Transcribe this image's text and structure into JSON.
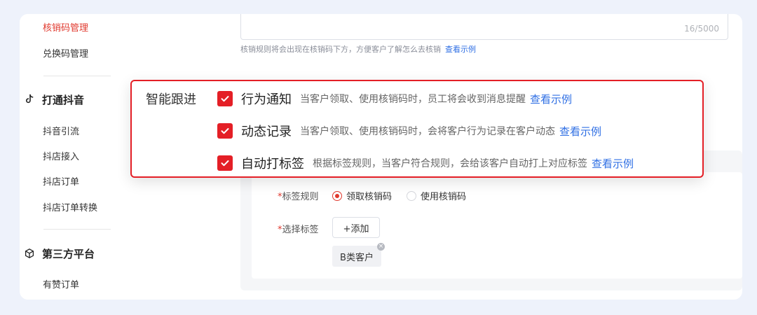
{
  "sidebar": {
    "items_top": [
      {
        "label": "核销码管理",
        "active": true
      },
      {
        "label": "兑换码管理",
        "active": false
      }
    ],
    "groups": [
      {
        "icon": "tiktok-icon",
        "title": "打通抖音",
        "items": [
          "抖音引流",
          "抖店接入",
          "抖店订单",
          "抖店订单转换"
        ]
      },
      {
        "icon": "cube-icon",
        "title": "第三方平台",
        "items": [
          "有赞订单"
        ]
      }
    ]
  },
  "rules_input": {
    "counter": "16/5000",
    "hint": "核销规则将会出现在核销码下方，方便客户了解怎么去核销",
    "hint_link": "查看示例"
  },
  "smart_follow": {
    "title": "智能跟进",
    "options": [
      {
        "label": "行为通知",
        "checked": true,
        "description": "当客户领取、使用核销码时，员工将会收到消息提醒",
        "link": "查看示例"
      },
      {
        "label": "动态记录",
        "checked": true,
        "description": "当客户领取、使用核销码时，会将客户行为记录在客户动态",
        "link": "查看示例"
      },
      {
        "label": "自动打标签",
        "checked": true,
        "description": "根据标签规则，当客户符合规则，会给该客户自动打上对应标签",
        "link": "查看示例"
      }
    ]
  },
  "tag_form": {
    "rule_label": "标签规则",
    "rule_options": [
      {
        "label": "领取核销码",
        "selected": true
      },
      {
        "label": "使用核销码",
        "selected": false
      }
    ],
    "select_label": "选择标签",
    "add_button": "+添加",
    "tags": [
      "B类客户"
    ],
    "required_mark": "*"
  },
  "colors": {
    "accent_red": "#e41f26",
    "link_blue": "#2f6fe4",
    "background": "#eef2fb"
  }
}
